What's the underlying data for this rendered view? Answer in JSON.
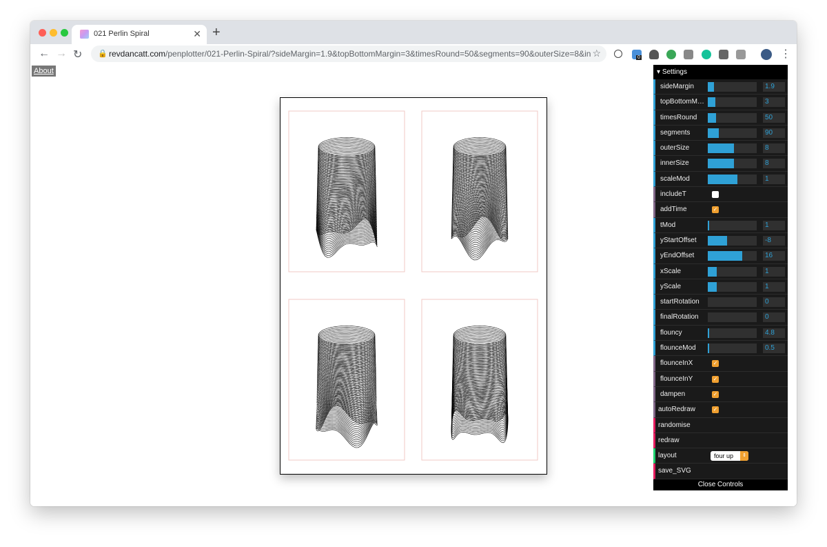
{
  "browser": {
    "tab_title": "021 Perlin Spiral",
    "url_domain": "revdancatt.com",
    "url_path": "/penplotter/021-Perlin-Spiral/?sideMargin=1.9&topBottomMargin=3&timesRound=50&segments=90&outerSize=8&inner...",
    "ext_badge": "0"
  },
  "page": {
    "about_link": "About"
  },
  "gui": {
    "header": "Settings",
    "controls": [
      {
        "label": "sideMargin",
        "kind": "slider",
        "value": "1.9",
        "fraction": 0.12
      },
      {
        "label": "topBottomMargin",
        "display": "topBottomMar...",
        "kind": "slider",
        "value": "3",
        "fraction": 0.15
      },
      {
        "label": "timesRound",
        "kind": "slider",
        "value": "50",
        "fraction": 0.17
      },
      {
        "label": "segments",
        "kind": "slider",
        "value": "90",
        "fraction": 0.22
      },
      {
        "label": "outerSize",
        "kind": "slider",
        "value": "8",
        "fraction": 0.54
      },
      {
        "label": "innerSize",
        "kind": "slider",
        "value": "8",
        "fraction": 0.54
      },
      {
        "label": "scaleMod",
        "kind": "slider",
        "value": "1",
        "fraction": 0.6
      },
      {
        "label": "includeT",
        "kind": "checkbox",
        "checked": false
      },
      {
        "label": "addTime",
        "kind": "checkbox",
        "checked": true
      },
      {
        "label": "tMod",
        "kind": "slider",
        "value": "1",
        "fraction": 0.03
      },
      {
        "label": "yStartOffset",
        "kind": "slider",
        "value": "-8",
        "fraction": 0.4
      },
      {
        "label": "yEndOffset",
        "kind": "slider",
        "value": "16",
        "fraction": 0.7
      },
      {
        "label": "xScale",
        "kind": "slider",
        "value": "1",
        "fraction": 0.18
      },
      {
        "label": "yScale",
        "kind": "slider",
        "value": "1",
        "fraction": 0.18
      },
      {
        "label": "startRotation",
        "kind": "slider",
        "value": "0",
        "fraction": 0
      },
      {
        "label": "finalRotation",
        "kind": "slider",
        "value": "0",
        "fraction": 0
      },
      {
        "label": "flouncy",
        "kind": "slider",
        "value": "4.8",
        "fraction": 0.03
      },
      {
        "label": "flounceMod",
        "kind": "slider",
        "value": "0.5",
        "fraction": 0.03
      },
      {
        "label": "flounceInX",
        "kind": "checkbox",
        "checked": true
      },
      {
        "label": "flounceInY",
        "kind": "checkbox",
        "checked": true
      },
      {
        "label": "dampen",
        "kind": "checkbox",
        "checked": true
      }
    ],
    "root_controls": [
      {
        "label": "autoRedraw",
        "kind": "checkbox",
        "checked": true
      },
      {
        "label": "randomise",
        "kind": "function"
      },
      {
        "label": "redraw",
        "kind": "function"
      },
      {
        "label": "layout",
        "kind": "select",
        "value": "four up"
      },
      {
        "label": "save_SVG",
        "kind": "function"
      }
    ],
    "close_label": "Close Controls"
  },
  "colors": {
    "slider": "#2fa1d6",
    "checkbox": "#f0a030",
    "function": "#e61d5f",
    "select": "#1ed36f"
  }
}
